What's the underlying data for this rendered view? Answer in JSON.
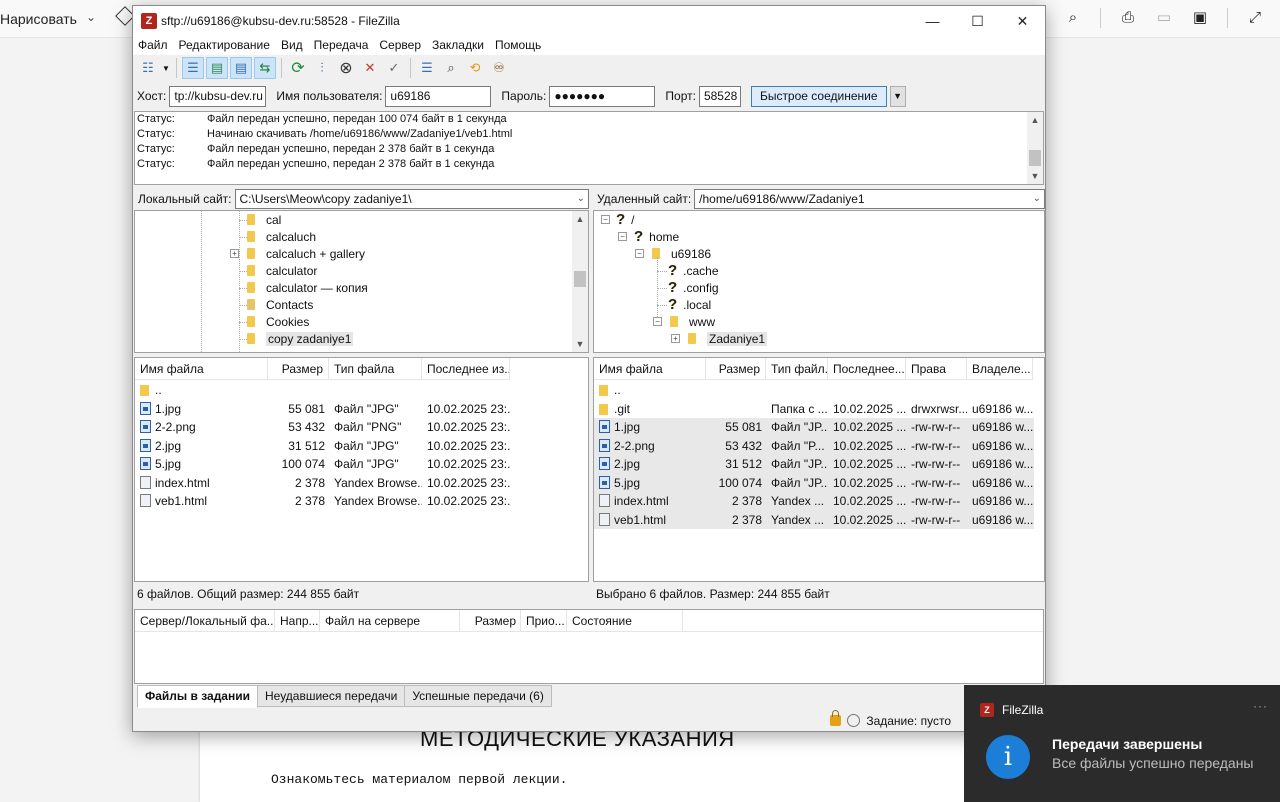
{
  "background": {
    "draw_label": "Нарисовать",
    "heading": "МЕТОДИЧЕСКИЕ УКАЗАНИЯ",
    "text": "Ознакомьтесь материалом первой лекции."
  },
  "window": {
    "title": "sftp://u69186@kubsu-dev.ru:58528 - FileZilla",
    "minimize": "—",
    "maximize": "☐",
    "close": "✕"
  },
  "menu": [
    "Файл",
    "Редактирование",
    "Вид",
    "Передача",
    "Сервер",
    "Закладки",
    "Помощь"
  ],
  "quickconnect": {
    "host_label": "Хост:",
    "host_value": "tp://kubsu-dev.ru",
    "user_label": "Имя пользователя:",
    "user_value": "u69186",
    "pass_label": "Пароль:",
    "pass_value": "●●●●●●●",
    "port_label": "Порт:",
    "port_value": "58528",
    "connect_label": "Быстрое соединение",
    "dropdown": "▼"
  },
  "log": [
    {
      "label": "Статус:",
      "text": "Файл передан успешно, передан 100 074 байт в 1 секунда"
    },
    {
      "label": "Статус:",
      "text": "Начинаю скачивать /home/u69186/www/Zadaniye1/veb1.html"
    },
    {
      "label": "Статус:",
      "text": "Файл передан успешно, передан 2 378 байт в 1 секунда"
    },
    {
      "label": "Статус:",
      "text": "Файл передан успешно, передан 2 378 байт в 1 секунда"
    }
  ],
  "local": {
    "site_label": "Локальный сайт:",
    "path": "C:\\Users\\Meow\\copy zadaniye1\\",
    "tree": [
      "cal",
      "calcaluch",
      "calcaluch + gallery",
      "calculator",
      "calculator — копия",
      "Contacts",
      "Cookies",
      "copy zadaniye1"
    ],
    "columns": [
      "Имя файла",
      "Размер",
      "Тип файла",
      "Последнее из..."
    ],
    "files": [
      {
        "name": "..",
        "size": "",
        "type": "",
        "modified": ""
      },
      {
        "name": "1.jpg",
        "size": "55 081",
        "type": "Файл \"JPG\"",
        "modified": "10.02.2025 23:..."
      },
      {
        "name": "2-2.png",
        "size": "53 432",
        "type": "Файл \"PNG\"",
        "modified": "10.02.2025 23:..."
      },
      {
        "name": "2.jpg",
        "size": "31 512",
        "type": "Файл \"JPG\"",
        "modified": "10.02.2025 23:..."
      },
      {
        "name": "5.jpg",
        "size": "100 074",
        "type": "Файл \"JPG\"",
        "modified": "10.02.2025 23:..."
      },
      {
        "name": "index.html",
        "size": "2 378",
        "type": "Yandex Browse...",
        "modified": "10.02.2025 23:..."
      },
      {
        "name": "veb1.html",
        "size": "2 378",
        "type": "Yandex Browse...",
        "modified": "10.02.2025 23:..."
      }
    ],
    "status": "6 файлов. Общий размер: 244 855 байт"
  },
  "remote": {
    "site_label": "Удаленный сайт:",
    "path": "/home/u69186/www/Zadaniye1",
    "tree": [
      "/",
      "home",
      "u69186",
      ".cache",
      ".config",
      ".local",
      "www",
      "Zadaniye1"
    ],
    "columns": [
      "Имя файла",
      "Размер",
      "Тип файл...",
      "Последнее...",
      "Права",
      "Владеле..."
    ],
    "files": [
      {
        "name": "..",
        "size": "",
        "type": "",
        "modified": "",
        "perms": "",
        "owner": ""
      },
      {
        "name": ".git",
        "size": "",
        "type": "Папка с ...",
        "modified": "10.02.2025 ...",
        "perms": "drwxrwsr...",
        "owner": "u69186 w..."
      },
      {
        "name": "1.jpg",
        "size": "55 081",
        "type": "Файл \"JP...",
        "modified": "10.02.2025 ...",
        "perms": "-rw-rw-r--",
        "owner": "u69186 w..."
      },
      {
        "name": "2-2.png",
        "size": "53 432",
        "type": "Файл \"P...",
        "modified": "10.02.2025 ...",
        "perms": "-rw-rw-r--",
        "owner": "u69186 w..."
      },
      {
        "name": "2.jpg",
        "size": "31 512",
        "type": "Файл \"JP...",
        "modified": "10.02.2025 ...",
        "perms": "-rw-rw-r--",
        "owner": "u69186 w..."
      },
      {
        "name": "5.jpg",
        "size": "100 074",
        "type": "Файл \"JP...",
        "modified": "10.02.2025 ...",
        "perms": "-rw-rw-r--",
        "owner": "u69186 w..."
      },
      {
        "name": "index.html",
        "size": "2 378",
        "type": "Yandex ...",
        "modified": "10.02.2025 ...",
        "perms": "-rw-rw-r--",
        "owner": "u69186 w..."
      },
      {
        "name": "veb1.html",
        "size": "2 378",
        "type": "Yandex ...",
        "modified": "10.02.2025 ...",
        "perms": "-rw-rw-r--",
        "owner": "u69186 w..."
      }
    ],
    "status": "Выбрано 6 файлов. Размер: 244 855 байт"
  },
  "queue": {
    "columns": [
      "Сервер/Локальный фа...",
      "Напр...",
      "Файл на сервере",
      "Размер",
      "Прио...",
      "Состояние"
    ]
  },
  "tabs": [
    "Файлы в задании",
    "Неудавшиеся передачи",
    "Успешные передачи (6)"
  ],
  "statusbar": {
    "queue": "Задание: пусто"
  },
  "toast": {
    "app": "FileZilla",
    "more": "···",
    "title": "Передачи завершены",
    "body": "Все файлы успешно переданы",
    "info_glyph": "i"
  }
}
